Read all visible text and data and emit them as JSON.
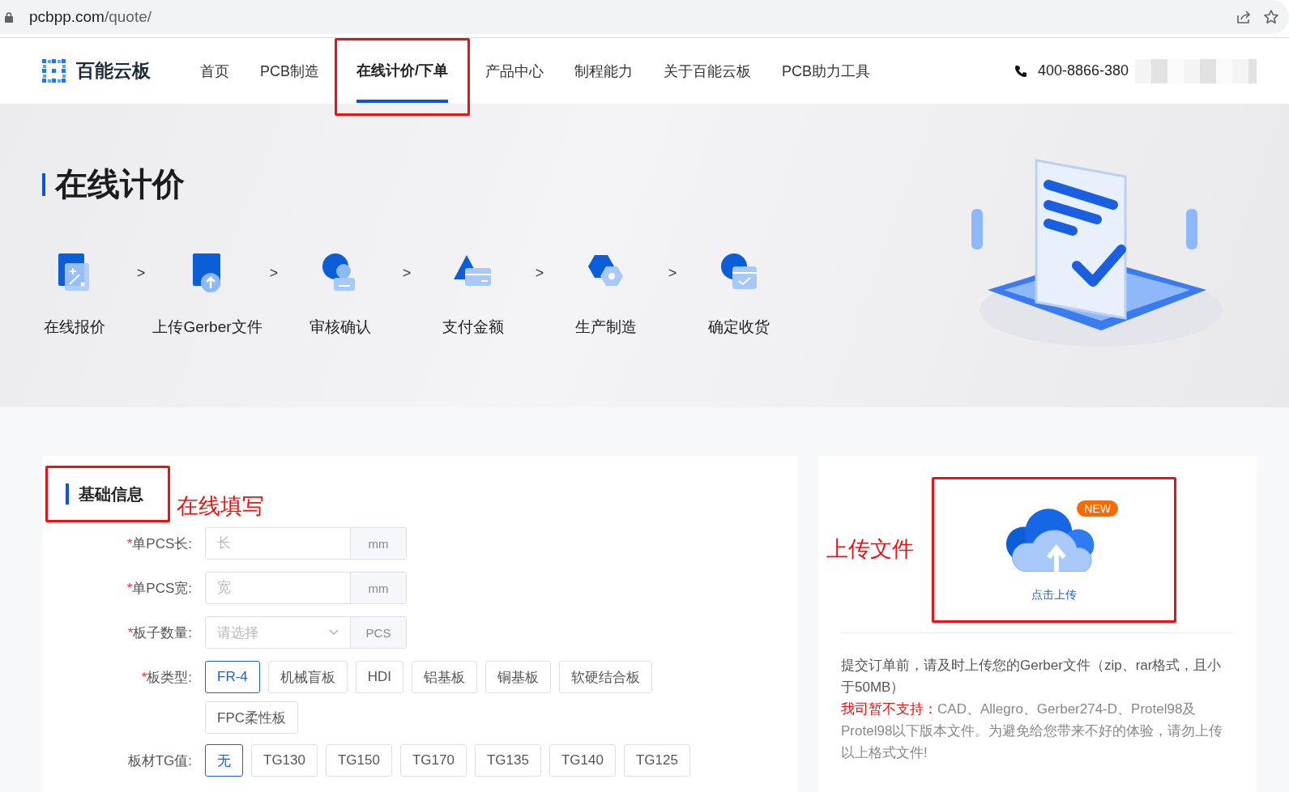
{
  "browser": {
    "url_host": "pcbpp.com",
    "url_path": "/quote/"
  },
  "header": {
    "brand": "百能云板",
    "nav": [
      {
        "label": "首页",
        "selected": false
      },
      {
        "label": "PCB制造",
        "selected": false
      },
      {
        "label": "在线计价/下单",
        "selected": true,
        "annotated": true
      },
      {
        "label": "产品中心",
        "selected": false
      },
      {
        "label": "制程能力",
        "selected": false
      },
      {
        "label": "关于百能云板",
        "selected": false
      },
      {
        "label": "PCB助力工具",
        "selected": false
      }
    ],
    "phone": "400-8866-380"
  },
  "hero": {
    "title": "在线计价",
    "steps": [
      {
        "label": "在线报价",
        "arrow": ">"
      },
      {
        "label": "上传Gerber文件",
        "arrow": ">"
      },
      {
        "label": "审核确认",
        "arrow": ">"
      },
      {
        "label": "支付金额",
        "arrow": ">"
      },
      {
        "label": "生产制造",
        "arrow": ">"
      },
      {
        "label": "确定收货"
      }
    ]
  },
  "form": {
    "title": "基础信息",
    "annotation": "在线填写",
    "rows": [
      {
        "kind": "input",
        "mark": "*",
        "label": "单PCS长:",
        "placeholder": "长",
        "unit": "mm"
      },
      {
        "kind": "input",
        "mark": "*",
        "label": "单PCS宽:",
        "placeholder": "宽",
        "unit": "mm"
      },
      {
        "kind": "select",
        "mark": "*",
        "label": "板子数量:",
        "placeholder": "请选择",
        "unit": "PCS"
      },
      {
        "kind": "options",
        "mark": "*",
        "label": "板类型:",
        "options": [
          {
            "label": "FR-4",
            "selected": true
          },
          {
            "label": "机械盲板",
            "selected": false
          },
          {
            "label": "HDI",
            "selected": false
          },
          {
            "label": "铝基板",
            "selected": false
          },
          {
            "label": "铜基板",
            "selected": false
          },
          {
            "label": "软硬结合板",
            "selected": false
          },
          {
            "label": "FPC柔性板",
            "selected": false
          }
        ]
      },
      {
        "kind": "options",
        "label": "板材TG值:",
        "options": [
          {
            "label": "无",
            "selected": true
          },
          {
            "label": "TG130",
            "selected": false
          },
          {
            "label": "TG150",
            "selected": false
          },
          {
            "label": "TG170",
            "selected": false
          },
          {
            "label": "TG135",
            "selected": false
          },
          {
            "label": "TG140",
            "selected": false
          },
          {
            "label": "TG125",
            "selected": false
          }
        ]
      }
    ]
  },
  "upload": {
    "annotation": "上传文件",
    "badge": "NEW",
    "button": "点击上传",
    "note": "提交订单前，请及时上传您的Gerber文件（zip、rar格式，且小于50MB）",
    "warning_label": "我司暂不支持：",
    "warning_text": "CAD、Allegro、Gerber274-D、Protel98及Protel98以下版本文件。为避免给您带来不好的体验，请勿上传以上格式文件!"
  }
}
